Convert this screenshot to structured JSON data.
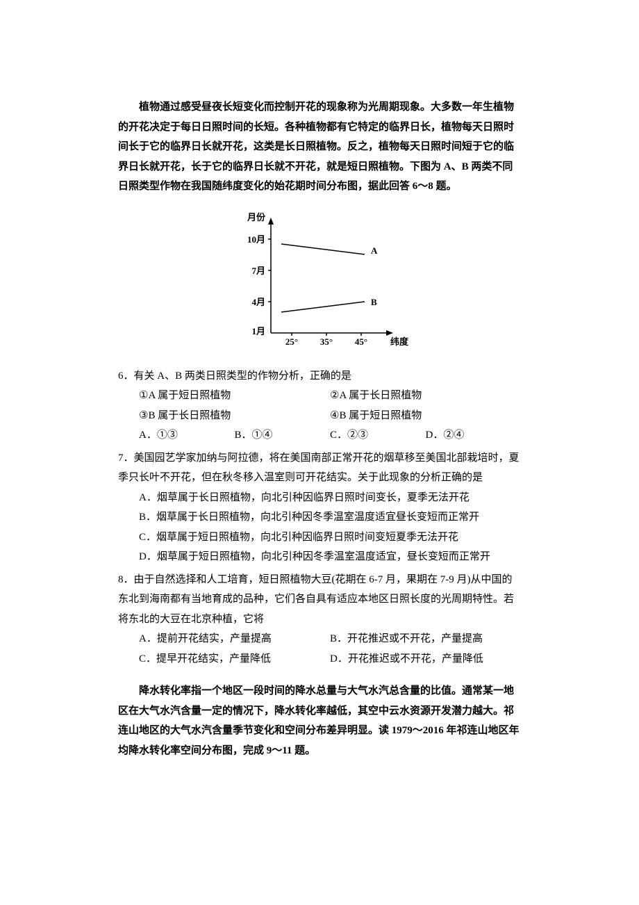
{
  "intro1": "植物通过感受昼夜长短变化而控制开花的现象称为光周期现象。大多数一年生植物的开花决定于每日日照时间的长短。各种植物都有它特定的临界日长，植物每天日照时间长于它的临界日长就开花，这类是长日照植物。反之，植物每天日照时间短于它的临界日长就开花，长于它的临界日长就不开花，就是短日照植物。下图为 A、B 两类不同日照类型作物在我国随纬度变化的始花期时间分布图，据此回答 6～8 题。",
  "intro2": "降水转化率指一个地区一段时间的降水总量与大气水汽总含量的比值。通常某一地区在大气水汽含量一定的情况下，降水转化率越低，其空中云水资源开发潜力越大。祁连山地区的大气水汽含量季节变化和空间分布差异明显。读 1979～2016 年祁连山地区年均降水转化率空间分布图，完成 9～11 题。",
  "q6": {
    "num": "6．",
    "stem": "有关 A、B 两类日照类型的作物分析，正确的是",
    "stmt1": "①A 属于短日照植物",
    "stmt2": "②A 属于长日照植物",
    "stmt3": "③B 属于长日照植物",
    "stmt4": "④B 属于短日照植物",
    "optA": "A．①③",
    "optB": "B．①④",
    "optC": "C．②③",
    "optD": "D．②④"
  },
  "q7": {
    "num": "7．",
    "stem": "美国园艺学家加纳与阿拉德，将在美国南部正常开花的烟草移至美国北部栽培时，夏季只长叶不开花，但在秋冬移入温室则可开花结实。关于此现象的分析正确的是",
    "optA": "A．烟草属于长日照植物，向北引种因临界日照时间变长，夏季无法开花",
    "optB": "B．烟草属于长日照植物，向北引种因冬季温室温度适宜昼长变短而正常开",
    "optC": "C．烟草属于短日照植物，向北引种因临界日照时间变短夏季无法开花",
    "optD": "D．烟草属于短日照植物，向北引种因冬季温室温度适宜，昼长变短而正常开"
  },
  "q8": {
    "num": "8．",
    "stem": "由于自然选择和人工培育，短日照植物大豆(花期在 6-7 月，果期在 7-9 月)从中国的东北到海南都有当地育成的品种，它们各自具有适应本地区日照长度的光周期特性。若将东北的大豆在北京种植，它将",
    "optA": "A．提前开花结实，产量提高",
    "optB": "B．开花推迟或不开花，产量提高",
    "optC": "C．提早开花结实，产量降低",
    "optD": "D．开花推迟或不开花，产量降低"
  },
  "chart": {
    "ylabel": "月份",
    "xlabel": "纬度",
    "yticks": [
      "10月",
      "7月",
      "4月",
      "1月"
    ],
    "xticks": [
      "25°",
      "35°",
      "45°"
    ],
    "seriesA": "A",
    "seriesB": "B"
  },
  "chart_data": {
    "type": "line",
    "title": "",
    "xlabel": "纬度",
    "ylabel": "月份",
    "x": [
      25,
      35,
      45
    ],
    "xlim": [
      25,
      50
    ],
    "ylim": [
      1,
      11
    ],
    "series": [
      {
        "name": "A",
        "values": [
          9.5,
          9.0,
          8.5
        ]
      },
      {
        "name": "B",
        "values": [
          3.0,
          3.5,
          4.0
        ]
      }
    ]
  }
}
